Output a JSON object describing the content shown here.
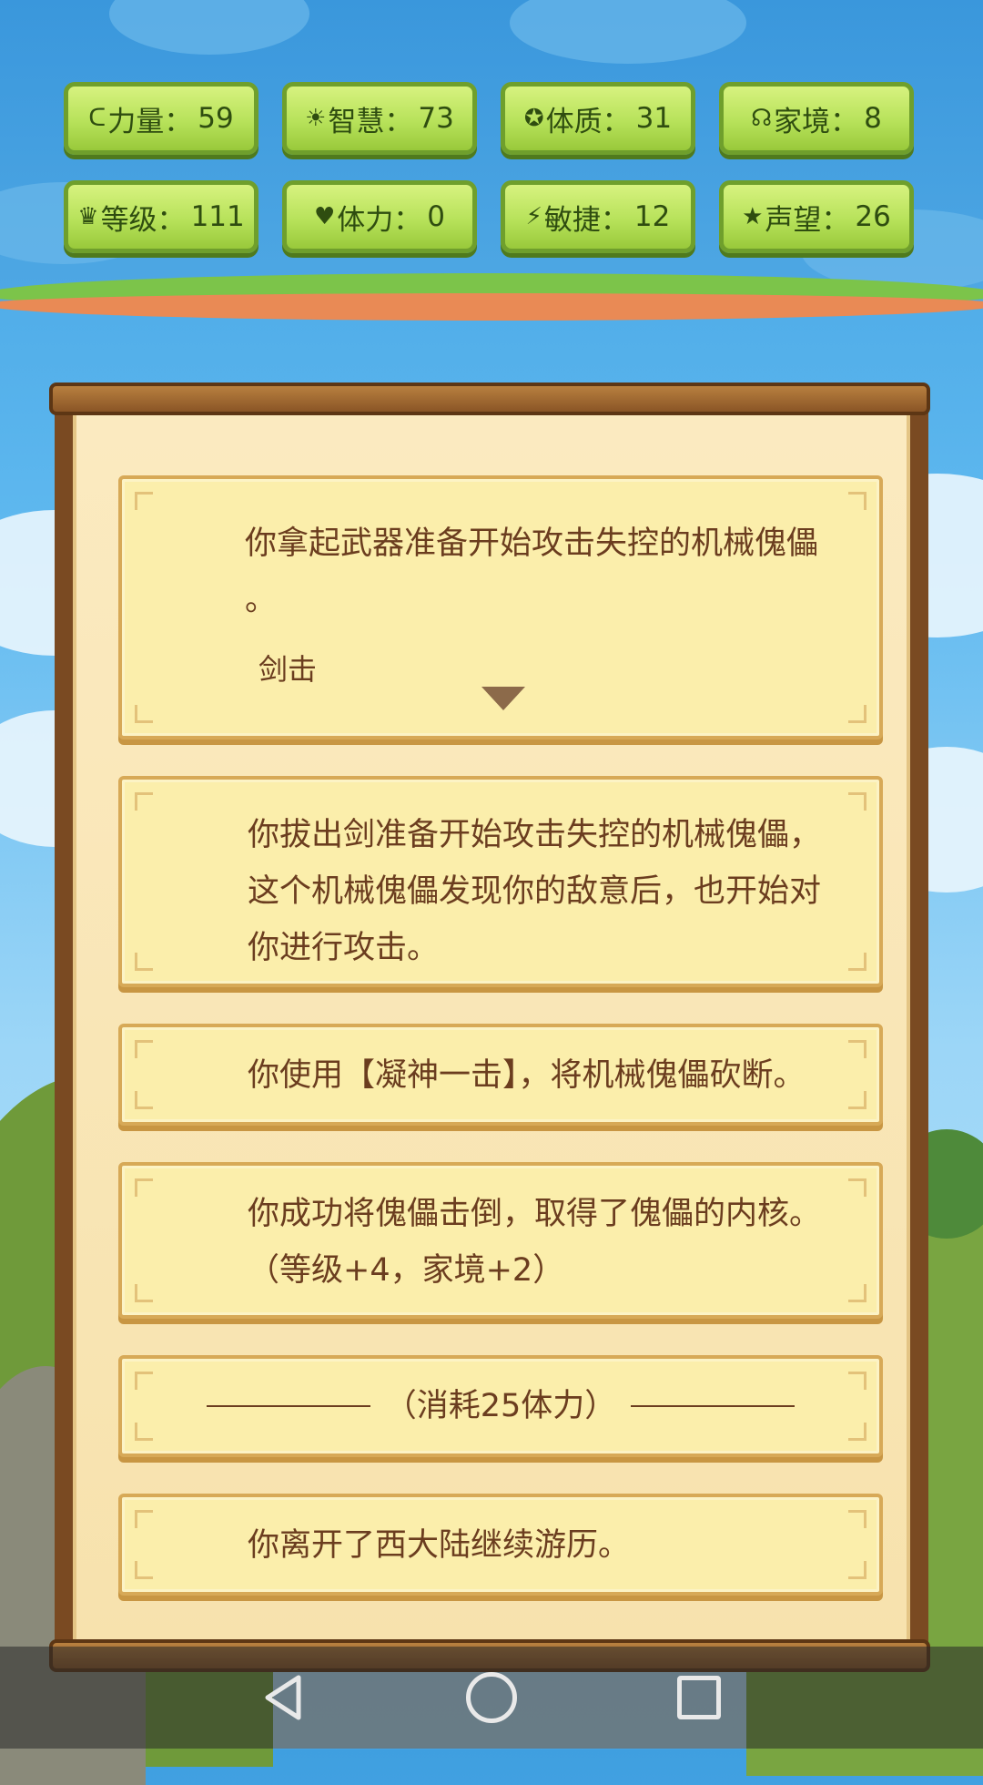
{
  "stats": [
    {
      "icon": "strength-icon",
      "glyph": "ᑕ",
      "label": "力量：",
      "value": "59"
    },
    {
      "icon": "wisdom-icon",
      "glyph": "☀",
      "label": "智慧：",
      "value": "73"
    },
    {
      "icon": "constitution-icon",
      "glyph": "✪",
      "label": "体质：",
      "value": "31"
    },
    {
      "icon": "family-icon",
      "glyph": "☊",
      "label": "家境：",
      "value": "8"
    },
    {
      "icon": "crown-icon",
      "glyph": "♛",
      "label": "等级：",
      "value": "111"
    },
    {
      "icon": "heart-icon",
      "glyph": "♥",
      "label": "体力：",
      "value": "0"
    },
    {
      "icon": "lightning-icon",
      "glyph": "⚡",
      "label": "敏捷：",
      "value": "12"
    },
    {
      "icon": "star-icon",
      "glyph": "★",
      "label": "声望：",
      "value": "26"
    }
  ],
  "events": {
    "e1_line1": "你拿起武器准备开始攻击失控的机械傀儡",
    "e1_line2": "。",
    "e1_choice": "剑击",
    "e2_line1": "你拔出剑准备开始攻击失控的机械傀儡，",
    "e2_line2": "这个机械傀儡发现你的敌意后，也开始对",
    "e2_line3": "你进行攻击。",
    "e3": "你使用【凝神一击】，将机械傀儡砍断。",
    "e4_line1": "你成功将傀儡击倒，取得了傀儡的内核。",
    "e4_line2": "（等级+4，家境+2）",
    "e5": "（消耗25体力）",
    "e6": "你离开了西大陆继续游历。"
  },
  "colors": {
    "stat_green": "#b7e25a",
    "card_bg": "#fbeeab",
    "text_brown": "#6b3d1f"
  }
}
